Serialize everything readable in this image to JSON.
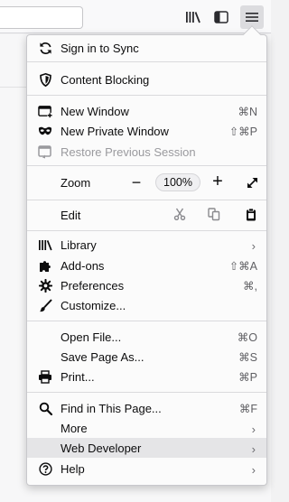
{
  "menu": {
    "sync": {
      "label": "Sign in to Sync",
      "icon": "sync-icon"
    },
    "content_blocking": {
      "label": "Content Blocking",
      "icon": "shield-icon"
    },
    "new_window": {
      "label": "New Window",
      "shortcut": "⌘N",
      "icon": "new-window-icon"
    },
    "private_window": {
      "label": "New Private Window",
      "shortcut": "⇧⌘P",
      "icon": "mask-icon"
    },
    "restore_session": {
      "label": "Restore Previous Session",
      "icon": "restore-icon"
    },
    "zoom": {
      "label": "Zoom",
      "minus": "−",
      "level": "100%",
      "plus": "+"
    },
    "edit": {
      "label": "Edit"
    },
    "library": {
      "label": "Library",
      "icon": "library-icon"
    },
    "addons": {
      "label": "Add-ons",
      "shortcut": "⇧⌘A",
      "icon": "puzzle-icon"
    },
    "preferences": {
      "label": "Preferences",
      "shortcut": "⌘,",
      "icon": "gear-icon"
    },
    "customize": {
      "label": "Customize...",
      "icon": "brush-icon"
    },
    "open_file": {
      "label": "Open File...",
      "shortcut": "⌘O"
    },
    "save_page": {
      "label": "Save Page As...",
      "shortcut": "⌘S"
    },
    "print": {
      "label": "Print...",
      "shortcut": "⌘P",
      "icon": "printer-icon"
    },
    "find": {
      "label": "Find in This Page...",
      "shortcut": "⌘F",
      "icon": "search-icon"
    },
    "more": {
      "label": "More"
    },
    "web_developer": {
      "label": "Web Developer"
    },
    "help": {
      "label": "Help",
      "icon": "help-icon"
    },
    "chevron": "›"
  },
  "toolbar": {
    "library_icon": "library-icon",
    "sidebar_icon": "sidebar-icon",
    "menu_icon": "hamburger-menu-icon"
  }
}
